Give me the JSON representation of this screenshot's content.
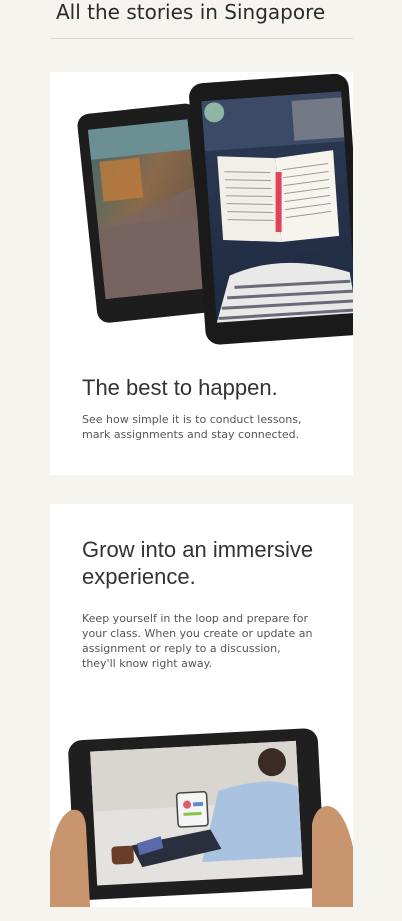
{
  "header": {
    "title": "All the stories in Singapore"
  },
  "cards": [
    {
      "title": "The best to happen.",
      "description": "See how simple it is to conduct lessons, mark assignments and stay connected.",
      "illustration_icon": "tablets-with-book-icon"
    },
    {
      "title": "Grow into an immersive experience.",
      "description": "Keep yourself in the loop and prepare for your class. When you create or update an assignment or reply to a discussion, they'll know right away.",
      "illustration_icon": "hands-holding-tablet-icon"
    }
  ],
  "colors": {
    "page_bg": "#f5f4ee",
    "card_bg": "#ffffff",
    "device_frame": "#1f1f1f"
  }
}
